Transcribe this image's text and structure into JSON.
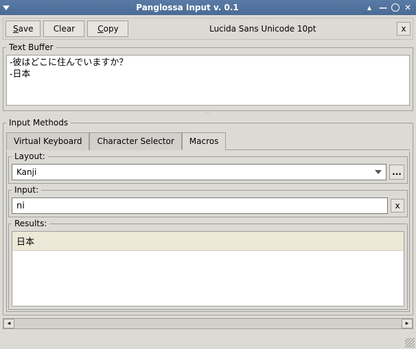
{
  "window": {
    "title": "Panglossa Input v. 0.1"
  },
  "toolbar": {
    "save": "Save",
    "clear": "Clear",
    "copy": "Copy",
    "font": "Lucida Sans Unicode 10pt",
    "close": "x"
  },
  "textbuffer": {
    "legend": "Text Buffer",
    "content": "-彼はどこに住んでいますか？\n-日本"
  },
  "inputmethods": {
    "legend": "Input Methods",
    "tabs": {
      "vk": "Virtual Keyboard",
      "cs": "Character Selector",
      "macros": "Macros"
    },
    "layout": {
      "label": "Layout:",
      "value": "Kanji",
      "browse": "..."
    },
    "input": {
      "legend": "Input:",
      "value": "ni",
      "clear": "x"
    },
    "results": {
      "legend": "Results:",
      "items": [
        "日本"
      ]
    }
  }
}
